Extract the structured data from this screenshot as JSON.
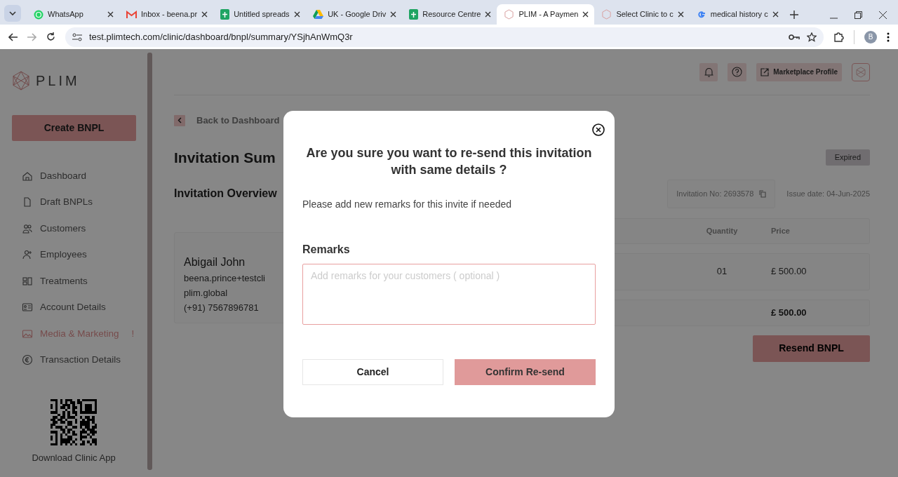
{
  "browser": {
    "tabs": [
      {
        "title": "WhatsApp",
        "kind": "whatsapp",
        "selected": false
      },
      {
        "title": "Inbox - beena.pr",
        "kind": "mail",
        "selected": false
      },
      {
        "title": "Untitled spreads",
        "kind": "sheet",
        "selected": false
      },
      {
        "title": "UK - Google Driv",
        "kind": "drive",
        "selected": false
      },
      {
        "title": "Resource Centre",
        "kind": "sheet",
        "selected": false
      },
      {
        "title": "PLIM - A Paymen",
        "kind": "plim",
        "selected": true
      },
      {
        "title": "Select Clinic to c",
        "kind": "plim",
        "selected": false
      },
      {
        "title": "medical history c",
        "kind": "google",
        "selected": false
      }
    ],
    "url": "test.plimtech.com/clinic/dashboard/bnpl/summary/YSjhAnWmQ3r",
    "profile_initial": "B"
  },
  "sidebar": {
    "logo": "PLIM",
    "create_button": "Create BNPL",
    "items": [
      {
        "label": "Dashboard",
        "attention": false
      },
      {
        "label": "Draft BNPLs",
        "attention": false
      },
      {
        "label": "Customers",
        "attention": false
      },
      {
        "label": "Employees",
        "attention": false
      },
      {
        "label": "Treatments",
        "attention": false
      },
      {
        "label": "Account Details",
        "attention": false
      },
      {
        "label": "Media & Marketing",
        "attention": true,
        "badge": "!"
      },
      {
        "label": "Transaction Details",
        "attention": false
      }
    ],
    "qr_caption": "Download Clinic App"
  },
  "header": {
    "profile_button": "Marketplace Profile"
  },
  "main": {
    "back_link": "Back to Dashboard",
    "title": "Invitation Sum",
    "status": "Expired",
    "section_title": "Invitation Overview",
    "invitation_no": "Invitation No: 2693578",
    "issue_date": "Issue date: 04-Jun-2025",
    "customer": {
      "name": "Abigail John",
      "lines": [
        "beena.prince+testcli",
        "plim.global",
        "(+91) 7567896781"
      ]
    },
    "table": {
      "columns": [
        "Quantity",
        "Price"
      ],
      "rows": [
        [
          "01",
          "£ 500.00"
        ]
      ],
      "total": "£ 500.00"
    },
    "resend_button": "Resend BNPL"
  },
  "modal": {
    "title": "Are you sure you want to re-send this invitation with same details ?",
    "message": "Please add new remarks for this invite if needed",
    "remarks_label": "Remarks",
    "placeholder": "Add remarks for your customers ( optional )",
    "cancel_button": "Cancel",
    "confirm_button": "Confirm Re-send"
  }
}
